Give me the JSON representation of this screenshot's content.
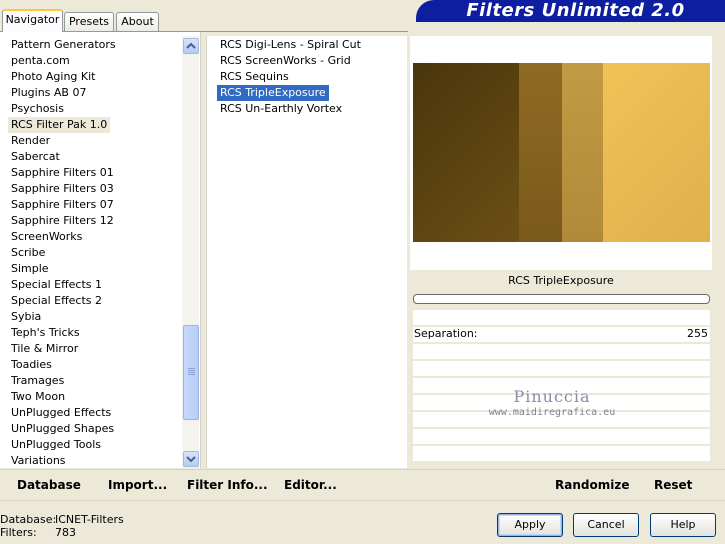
{
  "tabs": [
    {
      "label": "Navigator",
      "active": true
    },
    {
      "label": "Presets",
      "active": false
    },
    {
      "label": "About",
      "active": false
    }
  ],
  "title": "Filters Unlimited 2.0",
  "categories": [
    "Pattern Generators",
    "penta.com",
    "Photo Aging Kit",
    "Plugins AB 07",
    "Psychosis",
    "RCS Filter Pak 1.0",
    "Render",
    "Sabercat",
    "Sapphire Filters 01",
    "Sapphire Filters 03",
    "Sapphire Filters 07",
    "Sapphire Filters 12",
    "ScreenWorks",
    "Scribe",
    "Simple",
    "Special Effects 1",
    "Special Effects 2",
    "Sybia",
    "Teph's Tricks",
    "Tile & Mirror",
    "Toadies",
    "Tramages",
    "Two Moon",
    "UnPlugged Effects",
    "UnPlugged Shapes",
    "UnPlugged Tools",
    "Variations"
  ],
  "selected_category": "RCS Filter Pak 1.0",
  "filters": [
    "RCS Digi-Lens - Spiral Cut",
    "RCS ScreenWorks - Grid",
    "RCS Sequins",
    "RCS TripleExposure",
    "RCS Un-Earthly Vortex"
  ],
  "selected_filter": "RCS TripleExposure",
  "preview": {
    "colors": [
      "#5e4511",
      "#8f6a22",
      "#c39a44",
      "#f0c257"
    ],
    "filter_name": "RCS TripleExposure"
  },
  "params": [
    {
      "label": "Separation:",
      "value": "255"
    }
  ],
  "watermark": {
    "title": "Pinuccia",
    "subtitle": "www.maidiregrafica.eu"
  },
  "toolbar": {
    "database": "Database",
    "import": "Import...",
    "filter_info": "Filter Info...",
    "editor": "Editor...",
    "randomize": "Randomize",
    "reset": "Reset"
  },
  "info": {
    "database_label": "Database:",
    "database_value": "ICNET-Filters",
    "filters_label": "Filters:",
    "filters_value": "783"
  },
  "buttons": {
    "apply": "Apply",
    "cancel": "Cancel",
    "help": "Help"
  }
}
